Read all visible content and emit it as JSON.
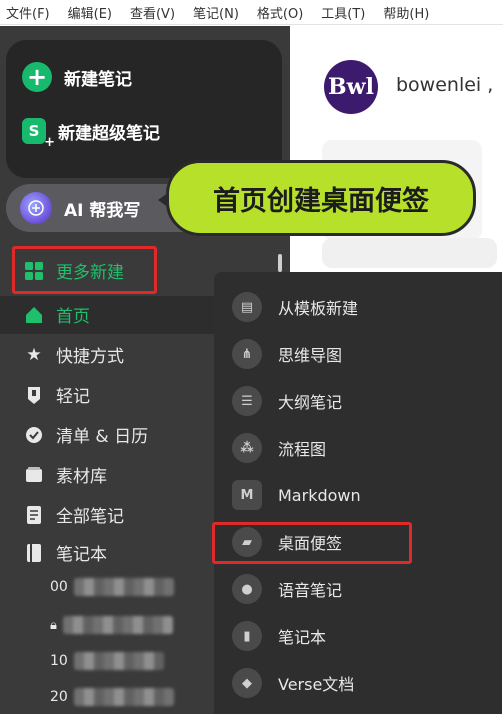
{
  "menubar": {
    "items": [
      "文件(F)",
      "编辑(E)",
      "查看(V)",
      "笔记(N)",
      "格式(O)",
      "工具(T)",
      "帮助(H)"
    ]
  },
  "sidebar": {
    "new_note": "新建笔记",
    "new_super_note": "新建超级笔记",
    "ai_write": "AI 帮我写",
    "more_new": "更多新建",
    "nav": [
      {
        "label": "首页",
        "icon": "home-icon"
      },
      {
        "label": "快捷方式",
        "icon": "star-icon"
      },
      {
        "label": "轻记",
        "icon": "quick-note-icon"
      },
      {
        "label": "清单 & 日历",
        "icon": "check-circle-icon"
      },
      {
        "label": "素材库",
        "icon": "library-icon"
      },
      {
        "label": "全部笔记",
        "icon": "notes-icon"
      },
      {
        "label": "笔记本",
        "icon": "notebook-icon"
      }
    ],
    "notebooks": [
      "00",
      "",
      "10",
      "20"
    ]
  },
  "content": {
    "avatar_text": "Bwl",
    "username": "bowenlei ,"
  },
  "callout": {
    "text": "首页创建桌面便签"
  },
  "submenu": {
    "items": [
      {
        "label": "从模板新建",
        "icon": "template-icon"
      },
      {
        "label": "思维导图",
        "icon": "mindmap-icon"
      },
      {
        "label": "大纲笔记",
        "icon": "outline-icon"
      },
      {
        "label": "流程图",
        "icon": "flowchart-icon"
      },
      {
        "label": "Markdown",
        "icon": "markdown-icon"
      },
      {
        "label": "桌面便签",
        "icon": "sticky-note-icon"
      },
      {
        "label": "语音笔记",
        "icon": "microphone-icon"
      },
      {
        "label": "笔记本",
        "icon": "notebook-icon"
      },
      {
        "label": "Verse文档",
        "icon": "verse-icon"
      }
    ]
  },
  "colors": {
    "accent_green": "#17b96c",
    "highlight_red": "#e02a2a",
    "callout_bg": "#b6e02a"
  }
}
